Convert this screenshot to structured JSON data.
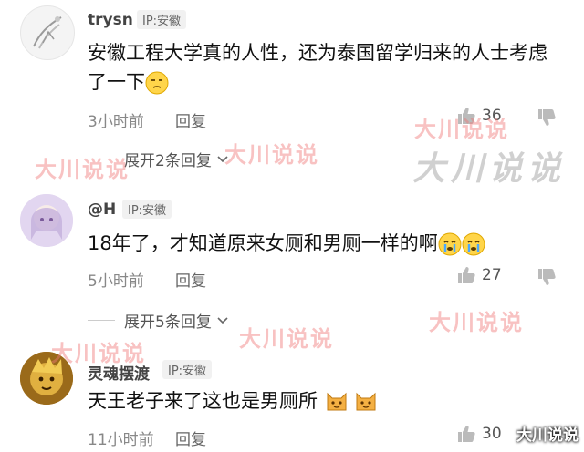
{
  "comments": [
    {
      "username": "trysn",
      "ip": "IP:安徽",
      "text": "安徽工程大学真的人性，还为泰国留学归来的人士考虑了一下",
      "time": "3小时前",
      "reply": "回复",
      "likes": "36",
      "expand": "展开2条回复"
    },
    {
      "username": "@H",
      "ip": "IP:安徽",
      "text": "18年了，才知道原来女厕和男厕一样的啊",
      "time": "5小时前",
      "reply": "回复",
      "likes": "27",
      "expand": "展开5条回复"
    },
    {
      "username": "灵魂摆渡",
      "ip": "IP:安徽",
      "text": "天王老子来了这也是男厕所",
      "time": "11小时前",
      "reply": "回复",
      "likes": "30"
    }
  ],
  "watermarks": {
    "small": "大川说说",
    "large": "大川说说",
    "corner": "大川说说"
  },
  "colors": {
    "watermark": "#f07878",
    "ip_tag_bg": "#f1f1f1",
    "meta_text": "#888888"
  }
}
